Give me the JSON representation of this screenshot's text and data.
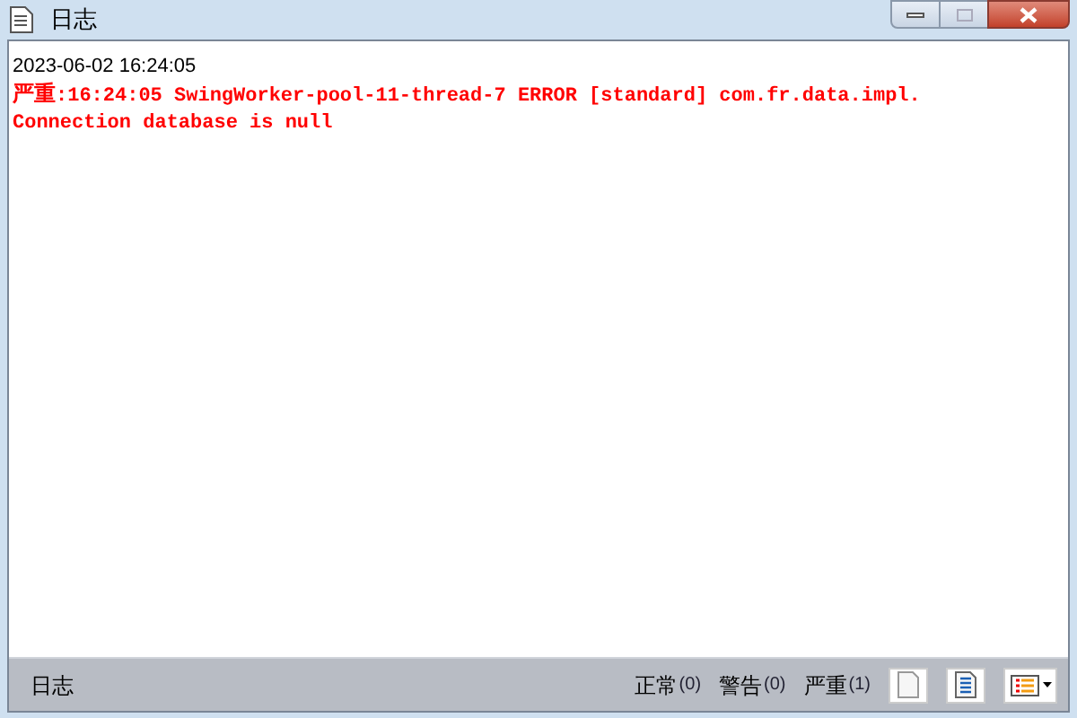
{
  "window": {
    "title": "日志"
  },
  "log": [
    {
      "kind": "timestamp",
      "text": "2023-06-02 16:24:05"
    },
    {
      "kind": "error",
      "label": "严重",
      "lines": [
        ":16:24:05 SwingWorker-pool-11-thread-7 ERROR [standard] com.fr.data.impl.",
        "Connection database is null"
      ]
    }
  ],
  "status_bar": {
    "title": "日志",
    "counts": [
      {
        "label": "正常",
        "count": "(0)"
      },
      {
        "label": "警告",
        "count": "(0)"
      },
      {
        "label": "严重",
        "count": "(1)"
      }
    ]
  }
}
